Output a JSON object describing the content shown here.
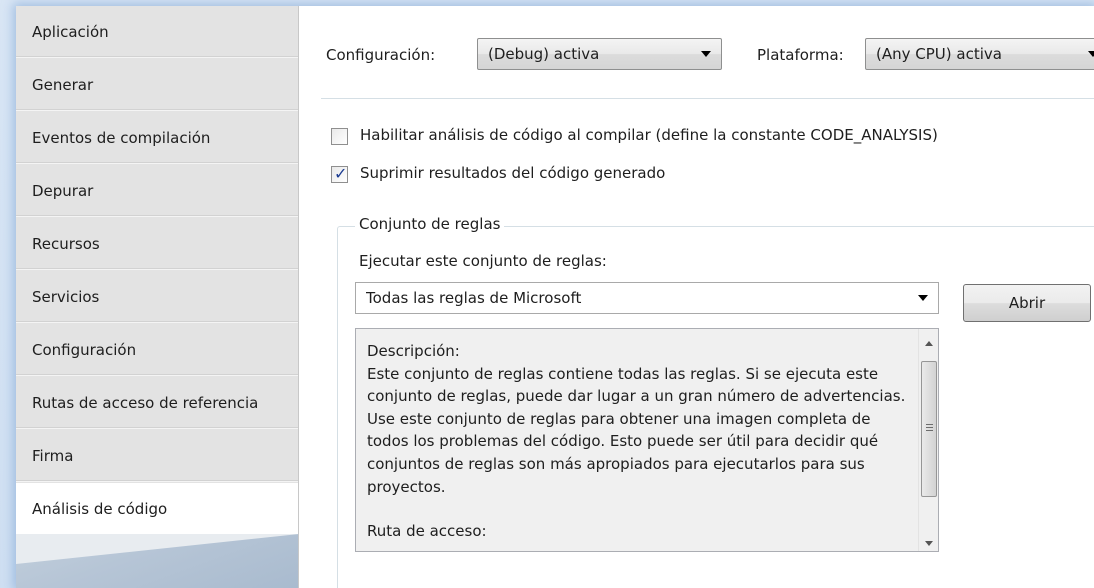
{
  "sidebar": {
    "items": [
      {
        "label": "Aplicación"
      },
      {
        "label": "Generar"
      },
      {
        "label": "Eventos de compilación"
      },
      {
        "label": "Depurar"
      },
      {
        "label": "Recursos"
      },
      {
        "label": "Servicios"
      },
      {
        "label": "Configuración"
      },
      {
        "label": "Rutas de acceso de referencia"
      },
      {
        "label": "Firma"
      },
      {
        "label": "Análisis de código"
      }
    ],
    "active_item": "Análisis de código"
  },
  "toolbar": {
    "configuration_label": "Configuración:",
    "configuration_value": "(Debug) activa",
    "platform_label": "Plataforma:",
    "platform_value": "(Any CPU) activa"
  },
  "options": {
    "enable_analysis_label": "Habilitar análisis de código al compilar (define la constante CODE_ANALYSIS)",
    "enable_analysis_checked": false,
    "suppress_generated_label": "Suprimir resultados del código generado",
    "suppress_generated_checked": true
  },
  "ruleset": {
    "group_title": "Conjunto de reglas",
    "run_label": "Ejecutar este conjunto de reglas:",
    "selected": "Todas las reglas de Microsoft",
    "open_button": "Abrir",
    "description_heading": "Descripción:",
    "description_body": "Este conjunto de reglas contiene todas las reglas. Si se ejecuta este conjunto de reglas, puede dar lugar a un gran número de advertencias. Use este conjunto de reglas para obtener una imagen completa de todos los problemas del código. Esto puede ser útil para decidir qué conjuntos de reglas son más apropiados para ejecutarlos para sus proyectos.",
    "path_label": "Ruta de acceso:"
  }
}
